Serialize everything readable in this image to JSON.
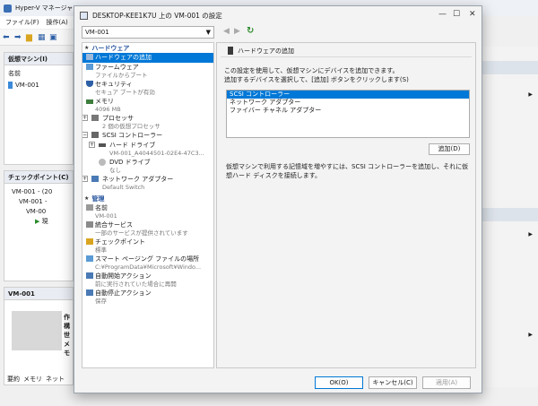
{
  "bg": {
    "title": "Hyper-V マネージャー",
    "menu": [
      "ファイル(F)",
      "操作(A)"
    ],
    "vm_pane_title": "仮想マシン(I)",
    "vm_col_name": "名前",
    "vm_row": "VM-001",
    "checkpoint_title": "チェックポイント(C)",
    "checkpoints": [
      "VM-001 - (20",
      "VM-001 -",
      "VM-00",
      "現"
    ],
    "detail_title": "VM-001",
    "detail_labels": [
      "作",
      "構",
      "世",
      "メモ"
    ],
    "bottom_tabs": [
      "要約",
      "メモリ",
      "ネット"
    ]
  },
  "dialog": {
    "title": "DESKTOP-KEE1K7U 上の VM-001 の設定",
    "vm_select": "VM-001",
    "ok": "OK(O)",
    "cancel": "キャンセル(C)",
    "apply": "適用(A)"
  },
  "tree": {
    "hardware_header": "ハードウェア",
    "add_hardware": "ハードウェアの追加",
    "firmware": "ファームウェア",
    "firmware_sub": "ファイルからブート",
    "security": "セキュリティ",
    "security_sub": "セキュア ブートが有効",
    "memory": "メモリ",
    "memory_sub": "4096 MB",
    "processor": "プロセッサ",
    "processor_sub": "2 個の仮想プロセッサ",
    "scsi": "SCSI コントローラー",
    "hdd": "ハード ドライブ",
    "hdd_sub": "VM-001_A4044501-02E4-47C3...",
    "dvd": "DVD ドライブ",
    "dvd_sub": "なし",
    "nic": "ネットワーク アダプター",
    "nic_sub": "Default Switch",
    "management_header": "管理",
    "name": "名前",
    "name_sub": "VM-001",
    "integration": "統合サービス",
    "integration_sub": "一部のサービスが提供されています",
    "checkpoint": "チェックポイント",
    "checkpoint_sub": "標準",
    "paging": "スマート ページング ファイルの場所",
    "paging_sub": "C:¥ProgramData¥Microsoft¥Windo...",
    "autostart": "自動開始アクション",
    "autostart_sub": "前に実行されていた場合に再開",
    "autostop": "自動停止アクション",
    "autostop_sub": "保存"
  },
  "panel": {
    "header": "ハードウェアの追加",
    "desc_line1": "この設定を使用して、仮想マシンにデバイスを追加できます。",
    "desc_line2": "追加するデバイスを選択して、[追加] ボタンをクリックします(S)",
    "options": [
      "SCSI コントローラー",
      "ネットワーク アダプター",
      "ファイバー チャネル アダプター"
    ],
    "add_button": "追加(D)",
    "note": "仮想マシンで利用する記憶域を増やすには、SCSI コントローラーを追加し、それに仮想ハード ディスクを接続します。"
  },
  "colors": {
    "selection": "#0078d7",
    "section_header": "#1f4e9a",
    "refresh_green": "#2a8a2a"
  }
}
